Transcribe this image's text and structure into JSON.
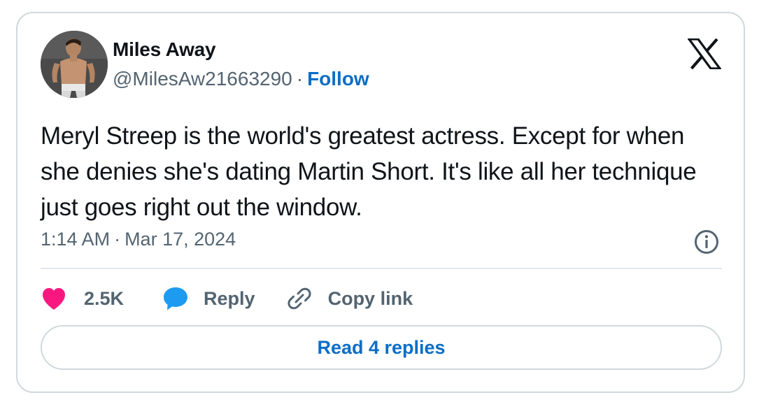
{
  "author": {
    "display_name": "Miles Away",
    "handle": "@MilesAw21663290",
    "separator": "·",
    "follow_label": "Follow",
    "avatar_icon": "profile-photo"
  },
  "brand": {
    "logo_icon": "x-logo-icon"
  },
  "tweet": {
    "text": "Meryl Streep is the world's greatest actress. Except for when she denies she's dating Martin Short. It's like all her technique just goes right out the window.",
    "time": "1:14 AM",
    "separator": "·",
    "date": "Mar 17, 2024"
  },
  "actions": {
    "like_count": "2.5K",
    "reply_label": "Reply",
    "copy_link_label": "Copy link",
    "read_replies_label": "Read 4 replies"
  },
  "colors": {
    "like": "#f91880",
    "reply": "#1d9bf0",
    "link": "#0a6ec7",
    "muted": "#536471",
    "border": "#cfd9de"
  }
}
